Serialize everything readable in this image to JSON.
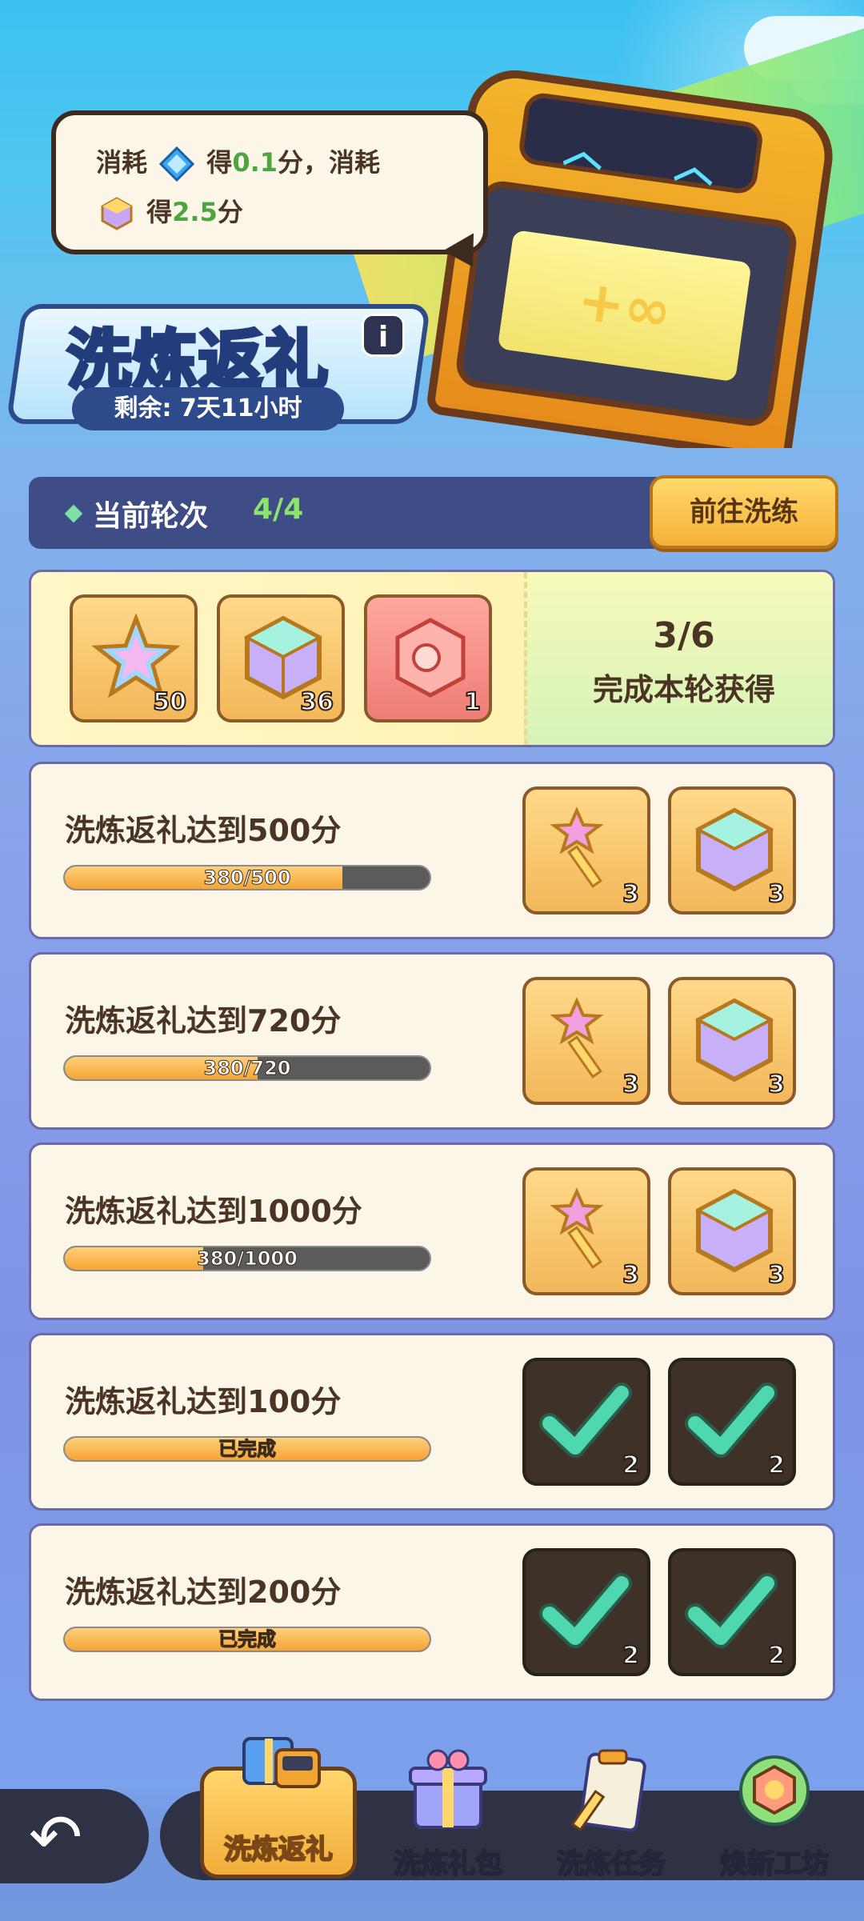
{
  "tooltip": {
    "line1_prefix": "消耗",
    "line1_mid": "得",
    "line1_value": "0.1",
    "line1_suffix": "分，消耗",
    "line2_mid": "得",
    "line2_value": "2.5",
    "line2_suffix": "分"
  },
  "event": {
    "title": "洗炼返礼",
    "info_icon": "i",
    "remaining": "剩余: 7天11小时"
  },
  "round": {
    "label": "当前轮次",
    "value": "4/4",
    "goto_button": "前往洗练"
  },
  "round_reward": {
    "items": [
      {
        "icon": "rainbow-star-icon",
        "count": "50"
      },
      {
        "icon": "rainbow-cube-icon",
        "count": "36"
      },
      {
        "icon": "red-crystal-icon",
        "count": "1"
      }
    ],
    "progress": "3/6",
    "description": "完成本轮获得"
  },
  "tasks": [
    {
      "label": "洗炼返礼达到500分",
      "progress_text": "380/500",
      "progress": 0.76,
      "done": false,
      "rewards": [
        {
          "icon": "star-key-icon",
          "count": "3"
        },
        {
          "icon": "rainbow-cube-icon",
          "count": "3"
        }
      ]
    },
    {
      "label": "洗炼返礼达到720分",
      "progress_text": "380/720",
      "progress": 0.5278,
      "done": false,
      "rewards": [
        {
          "icon": "star-key-icon",
          "count": "3"
        },
        {
          "icon": "rainbow-cube-icon",
          "count": "3"
        }
      ]
    },
    {
      "label": "洗炼返礼达到1000分",
      "progress_text": "380/1000",
      "progress": 0.38,
      "done": false,
      "rewards": [
        {
          "icon": "star-key-icon",
          "count": "3"
        },
        {
          "icon": "rainbow-cube-icon",
          "count": "3"
        }
      ]
    },
    {
      "label": "洗炼返礼达到100分",
      "progress_text": "已完成",
      "progress": 1.0,
      "done": true,
      "rewards": [
        {
          "icon": "star-key-icon",
          "count": "2"
        },
        {
          "icon": "rainbow-cube-icon",
          "count": "2"
        }
      ]
    },
    {
      "label": "洗炼返礼达到200分",
      "progress_text": "已完成",
      "progress": 1.0,
      "done": true,
      "rewards": [
        {
          "icon": "star-key-icon",
          "count": "2"
        },
        {
          "icon": "rainbow-cube-icon",
          "count": "2"
        }
      ]
    }
  ],
  "nav": {
    "back_icon": "back-arrow-icon",
    "items": [
      {
        "label": "洗炼返礼",
        "icon": "gift-robot-icon",
        "active": true
      },
      {
        "label": "洗炼礼包",
        "icon": "gift-box-icon",
        "active": false
      },
      {
        "label": "洗炼任务",
        "icon": "clipboard-icon",
        "active": false
      },
      {
        "label": "焕新工坊",
        "icon": "workshop-icon",
        "active": false
      }
    ]
  },
  "colors": {
    "accent_green": "#4ca53f",
    "progress_fill": "#f5a533",
    "check_green": "#4fd8b0"
  }
}
